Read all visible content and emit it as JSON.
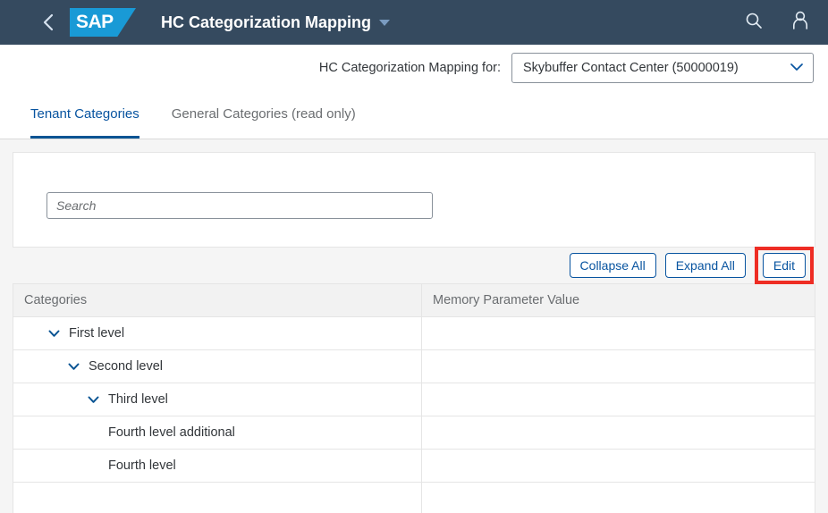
{
  "shell": {
    "back_icon": "chevron-left-icon",
    "logo_text": "SAP",
    "title": "HC Categorization Mapping",
    "title_caret_icon": "caret-down-icon",
    "search_icon": "search-icon",
    "user_icon": "user-icon",
    "background_color": "#354a5f",
    "logo_color": "#199ad6"
  },
  "subheader": {
    "label": "HC Categorization Mapping for:",
    "select": {
      "value": "Skybuffer Contact Center (50000019)",
      "chevron_icon": "chevron-down-icon"
    }
  },
  "tabs": [
    {
      "label": "Tenant Categories",
      "active": true
    },
    {
      "label": "General Categories (read only)",
      "active": false
    }
  ],
  "filter": {
    "search": {
      "value": "",
      "placeholder": "Search"
    }
  },
  "toolbar": {
    "collapse_all_label": "Collapse All",
    "expand_all_label": "Expand All",
    "edit_label": "Edit",
    "highlight_color": "#ee2d24",
    "button_color": "#0854a0"
  },
  "table": {
    "columns": [
      {
        "label": "Categories"
      },
      {
        "label": "Memory Parameter Value"
      }
    ],
    "rows": [
      {
        "label": "First level",
        "level": 0,
        "expanded": true,
        "has_children": true,
        "value": ""
      },
      {
        "label": "Second level",
        "level": 1,
        "expanded": true,
        "has_children": true,
        "value": ""
      },
      {
        "label": "Third level",
        "level": 2,
        "expanded": true,
        "has_children": true,
        "value": ""
      },
      {
        "label": "Fourth level additional",
        "level": 3,
        "expanded": false,
        "has_children": false,
        "value": ""
      },
      {
        "label": "Fourth level",
        "level": 3,
        "expanded": false,
        "has_children": false,
        "value": ""
      },
      {
        "label": "",
        "level": 0,
        "expanded": false,
        "has_children": false,
        "value": ""
      }
    ]
  }
}
